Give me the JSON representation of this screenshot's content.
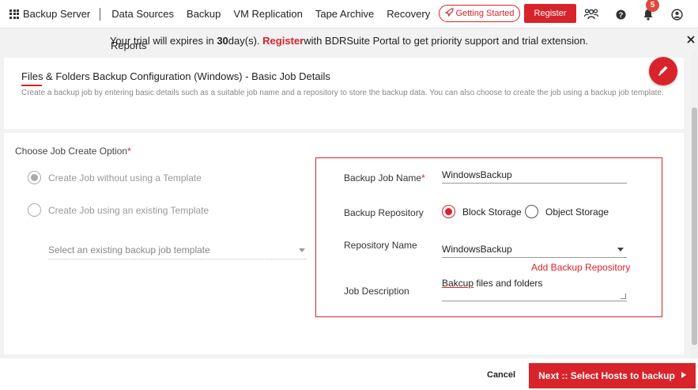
{
  "nav": {
    "brand": "Backup Server",
    "items": [
      "Data Sources",
      "Backup",
      "VM Replication",
      "Tape Archive",
      "Recovery"
    ],
    "reports": "Reports",
    "getting_started": "Getting Started",
    "register": "Register",
    "notification_count": "5"
  },
  "trial": {
    "prefix": "Your trial will expires in ",
    "days": "30",
    "middle": " day(s). ",
    "register": "Register",
    "suffix": " with BDRSuite Portal to get priority support and trial extension."
  },
  "header": {
    "title": "Files & Folders Backup Configuration (Windows) - Basic Job Details",
    "description": "Create a backup job by entering basic details such as a suitable job name and a repository to store the backup data. You can also choose to create the job using a backup job template."
  },
  "job_option": {
    "label": "Choose Job Create Option",
    "required": "*",
    "options": [
      "Create Job without using a Template",
      "Create Job using an existing Template"
    ],
    "template_placeholder": "Select an existing backup job template"
  },
  "form": {
    "job_name_label": "Backup Job Name",
    "job_name_required": "*",
    "job_name_value": "WindowsBackup",
    "repository_label": "Backup Repository",
    "repository_options": [
      "Block Storage",
      "Object Storage"
    ],
    "repo_name_label": "Repository Name",
    "repo_name_value": "WindowsBackup",
    "add_repo": "Add Backup Repository",
    "job_desc_label": "Job Description",
    "job_desc_word1": "Bakcup",
    "job_desc_rest": " files and folders"
  },
  "footer": {
    "cancel": "Cancel",
    "next": "Next :: Select Hosts to backup"
  },
  "colors": {
    "accent": "#d9232a"
  }
}
